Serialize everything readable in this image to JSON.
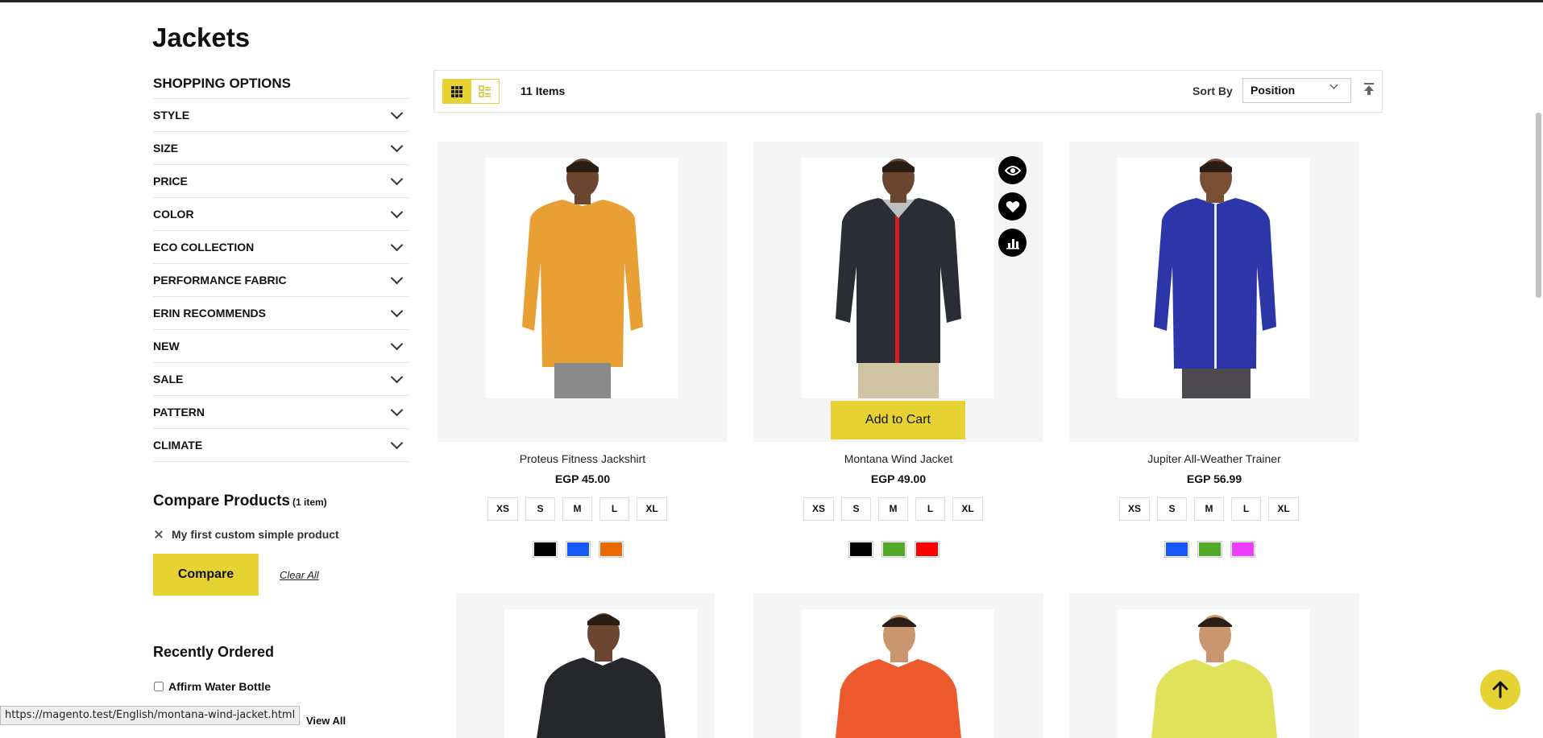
{
  "page": {
    "title": "Jackets"
  },
  "sidebar": {
    "title": "SHOPPING OPTIONS",
    "filters": [
      "STYLE",
      "SIZE",
      "PRICE",
      "COLOR",
      "ECO COLLECTION",
      "PERFORMANCE FABRIC",
      "ERIN RECOMMENDS",
      "NEW",
      "SALE",
      "PATTERN",
      "CLIMATE"
    ]
  },
  "compare": {
    "title": "Compare Products",
    "count": "(1 item)",
    "items": [
      {
        "name": "My first custom simple product"
      }
    ],
    "button_label": "Compare",
    "clear_label": "Clear All"
  },
  "recently_ordered": {
    "title": "Recently Ordered",
    "items": [
      {
        "name": "Affirm Water Bottle"
      }
    ],
    "view_all_label": "View All"
  },
  "toolbar": {
    "items_count": "11 Items",
    "sort_label": "Sort By",
    "sort_value": "Position",
    "grid_icon": "grid-view-icon",
    "list_icon": "list-view-icon",
    "sort_direction_icon": "arrow-up-icon"
  },
  "products": [
    {
      "name": "Proteus Fitness Jackshirt",
      "price": "EGP 45.00",
      "sizes": [
        "XS",
        "S",
        "M",
        "L",
        "XL"
      ],
      "colors": [
        "#000000",
        "#1857f7",
        "#eb6703"
      ],
      "jacket_color": "#e8a035"
    },
    {
      "name": "Montana Wind Jacket",
      "price": "EGP 49.00",
      "sizes": [
        "XS",
        "S",
        "M",
        "L",
        "XL"
      ],
      "colors": [
        "#000000",
        "#53a828",
        "#ff0000"
      ],
      "jacket_color": "#2a2d33",
      "add_to_cart": "Add to Cart",
      "hover": true
    },
    {
      "name": "Jupiter All-Weather Trainer",
      "price": "EGP 56.99",
      "sizes": [
        "XS",
        "S",
        "M",
        "L",
        "XL"
      ],
      "colors": [
        "#1857f7",
        "#53a828",
        "#ef3dff"
      ],
      "jacket_color": "#2d36a8"
    },
    {
      "jacket_color": "#25272b"
    },
    {
      "jacket_color": "#ec5a2e"
    },
    {
      "jacket_color": "#dfe25a"
    }
  ],
  "quick_actions": [
    "quick-view-icon",
    "wishlist-heart-icon",
    "compare-chart-icon"
  ],
  "status_bar": {
    "url": "https://magento.test/English/montana-wind-jacket.html"
  },
  "colors": {
    "accent": "#e6d233"
  }
}
